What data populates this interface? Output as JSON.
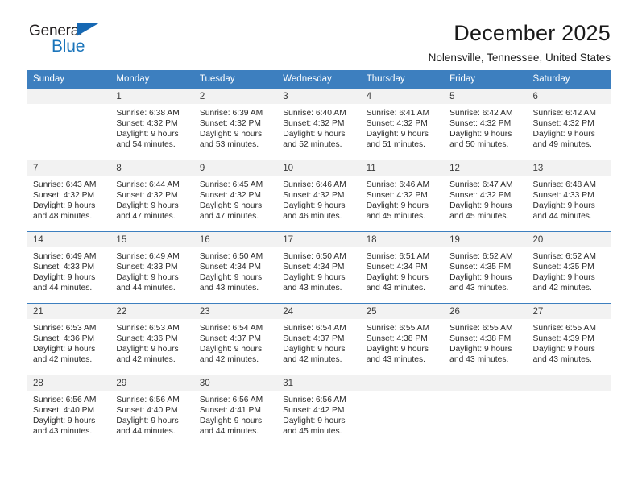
{
  "brand": {
    "name_part1": "General",
    "name_part2": "Blue",
    "triangle_color": "#1668b3",
    "blue_color": "#1b75bb"
  },
  "header": {
    "title": "December 2025",
    "subtitle": "Nolensville, Tennessee, United States"
  },
  "theme": {
    "header_bg": "#3d7fbf",
    "header_text": "#ffffff",
    "daynum_bg": "#f2f2f2",
    "cell_bg": "#ffffff",
    "rule_color": "#3d7fbf"
  },
  "weekday_headers": [
    "Sunday",
    "Monday",
    "Tuesday",
    "Wednesday",
    "Thursday",
    "Friday",
    "Saturday"
  ],
  "weeks": [
    [
      {
        "day": "",
        "empty": true,
        "sunrise": "",
        "sunset": "",
        "daylight": ""
      },
      {
        "day": "1",
        "sunrise": "Sunrise: 6:38 AM",
        "sunset": "Sunset: 4:32 PM",
        "daylight": "Daylight: 9 hours and 54 minutes."
      },
      {
        "day": "2",
        "sunrise": "Sunrise: 6:39 AM",
        "sunset": "Sunset: 4:32 PM",
        "daylight": "Daylight: 9 hours and 53 minutes."
      },
      {
        "day": "3",
        "sunrise": "Sunrise: 6:40 AM",
        "sunset": "Sunset: 4:32 PM",
        "daylight": "Daylight: 9 hours and 52 minutes."
      },
      {
        "day": "4",
        "sunrise": "Sunrise: 6:41 AM",
        "sunset": "Sunset: 4:32 PM",
        "daylight": "Daylight: 9 hours and 51 minutes."
      },
      {
        "day": "5",
        "sunrise": "Sunrise: 6:42 AM",
        "sunset": "Sunset: 4:32 PM",
        "daylight": "Daylight: 9 hours and 50 minutes."
      },
      {
        "day": "6",
        "sunrise": "Sunrise: 6:42 AM",
        "sunset": "Sunset: 4:32 PM",
        "daylight": "Daylight: 9 hours and 49 minutes."
      }
    ],
    [
      {
        "day": "7",
        "sunrise": "Sunrise: 6:43 AM",
        "sunset": "Sunset: 4:32 PM",
        "daylight": "Daylight: 9 hours and 48 minutes."
      },
      {
        "day": "8",
        "sunrise": "Sunrise: 6:44 AM",
        "sunset": "Sunset: 4:32 PM",
        "daylight": "Daylight: 9 hours and 47 minutes."
      },
      {
        "day": "9",
        "sunrise": "Sunrise: 6:45 AM",
        "sunset": "Sunset: 4:32 PM",
        "daylight": "Daylight: 9 hours and 47 minutes."
      },
      {
        "day": "10",
        "sunrise": "Sunrise: 6:46 AM",
        "sunset": "Sunset: 4:32 PM",
        "daylight": "Daylight: 9 hours and 46 minutes."
      },
      {
        "day": "11",
        "sunrise": "Sunrise: 6:46 AM",
        "sunset": "Sunset: 4:32 PM",
        "daylight": "Daylight: 9 hours and 45 minutes."
      },
      {
        "day": "12",
        "sunrise": "Sunrise: 6:47 AM",
        "sunset": "Sunset: 4:32 PM",
        "daylight": "Daylight: 9 hours and 45 minutes."
      },
      {
        "day": "13",
        "sunrise": "Sunrise: 6:48 AM",
        "sunset": "Sunset: 4:33 PM",
        "daylight": "Daylight: 9 hours and 44 minutes."
      }
    ],
    [
      {
        "day": "14",
        "sunrise": "Sunrise: 6:49 AM",
        "sunset": "Sunset: 4:33 PM",
        "daylight": "Daylight: 9 hours and 44 minutes."
      },
      {
        "day": "15",
        "sunrise": "Sunrise: 6:49 AM",
        "sunset": "Sunset: 4:33 PM",
        "daylight": "Daylight: 9 hours and 44 minutes."
      },
      {
        "day": "16",
        "sunrise": "Sunrise: 6:50 AM",
        "sunset": "Sunset: 4:34 PM",
        "daylight": "Daylight: 9 hours and 43 minutes."
      },
      {
        "day": "17",
        "sunrise": "Sunrise: 6:50 AM",
        "sunset": "Sunset: 4:34 PM",
        "daylight": "Daylight: 9 hours and 43 minutes."
      },
      {
        "day": "18",
        "sunrise": "Sunrise: 6:51 AM",
        "sunset": "Sunset: 4:34 PM",
        "daylight": "Daylight: 9 hours and 43 minutes."
      },
      {
        "day": "19",
        "sunrise": "Sunrise: 6:52 AM",
        "sunset": "Sunset: 4:35 PM",
        "daylight": "Daylight: 9 hours and 43 minutes."
      },
      {
        "day": "20",
        "sunrise": "Sunrise: 6:52 AM",
        "sunset": "Sunset: 4:35 PM",
        "daylight": "Daylight: 9 hours and 42 minutes."
      }
    ],
    [
      {
        "day": "21",
        "sunrise": "Sunrise: 6:53 AM",
        "sunset": "Sunset: 4:36 PM",
        "daylight": "Daylight: 9 hours and 42 minutes."
      },
      {
        "day": "22",
        "sunrise": "Sunrise: 6:53 AM",
        "sunset": "Sunset: 4:36 PM",
        "daylight": "Daylight: 9 hours and 42 minutes."
      },
      {
        "day": "23",
        "sunrise": "Sunrise: 6:54 AM",
        "sunset": "Sunset: 4:37 PM",
        "daylight": "Daylight: 9 hours and 42 minutes."
      },
      {
        "day": "24",
        "sunrise": "Sunrise: 6:54 AM",
        "sunset": "Sunset: 4:37 PM",
        "daylight": "Daylight: 9 hours and 42 minutes."
      },
      {
        "day": "25",
        "sunrise": "Sunrise: 6:55 AM",
        "sunset": "Sunset: 4:38 PM",
        "daylight": "Daylight: 9 hours and 43 minutes."
      },
      {
        "day": "26",
        "sunrise": "Sunrise: 6:55 AM",
        "sunset": "Sunset: 4:38 PM",
        "daylight": "Daylight: 9 hours and 43 minutes."
      },
      {
        "day": "27",
        "sunrise": "Sunrise: 6:55 AM",
        "sunset": "Sunset: 4:39 PM",
        "daylight": "Daylight: 9 hours and 43 minutes."
      }
    ],
    [
      {
        "day": "28",
        "sunrise": "Sunrise: 6:56 AM",
        "sunset": "Sunset: 4:40 PM",
        "daylight": "Daylight: 9 hours and 43 minutes."
      },
      {
        "day": "29",
        "sunrise": "Sunrise: 6:56 AM",
        "sunset": "Sunset: 4:40 PM",
        "daylight": "Daylight: 9 hours and 44 minutes."
      },
      {
        "day": "30",
        "sunrise": "Sunrise: 6:56 AM",
        "sunset": "Sunset: 4:41 PM",
        "daylight": "Daylight: 9 hours and 44 minutes."
      },
      {
        "day": "31",
        "sunrise": "Sunrise: 6:56 AM",
        "sunset": "Sunset: 4:42 PM",
        "daylight": "Daylight: 9 hours and 45 minutes."
      },
      {
        "day": "",
        "empty": true,
        "sunrise": "",
        "sunset": "",
        "daylight": ""
      },
      {
        "day": "",
        "empty": true,
        "sunrise": "",
        "sunset": "",
        "daylight": ""
      },
      {
        "day": "",
        "empty": true,
        "sunrise": "",
        "sunset": "",
        "daylight": ""
      }
    ]
  ]
}
